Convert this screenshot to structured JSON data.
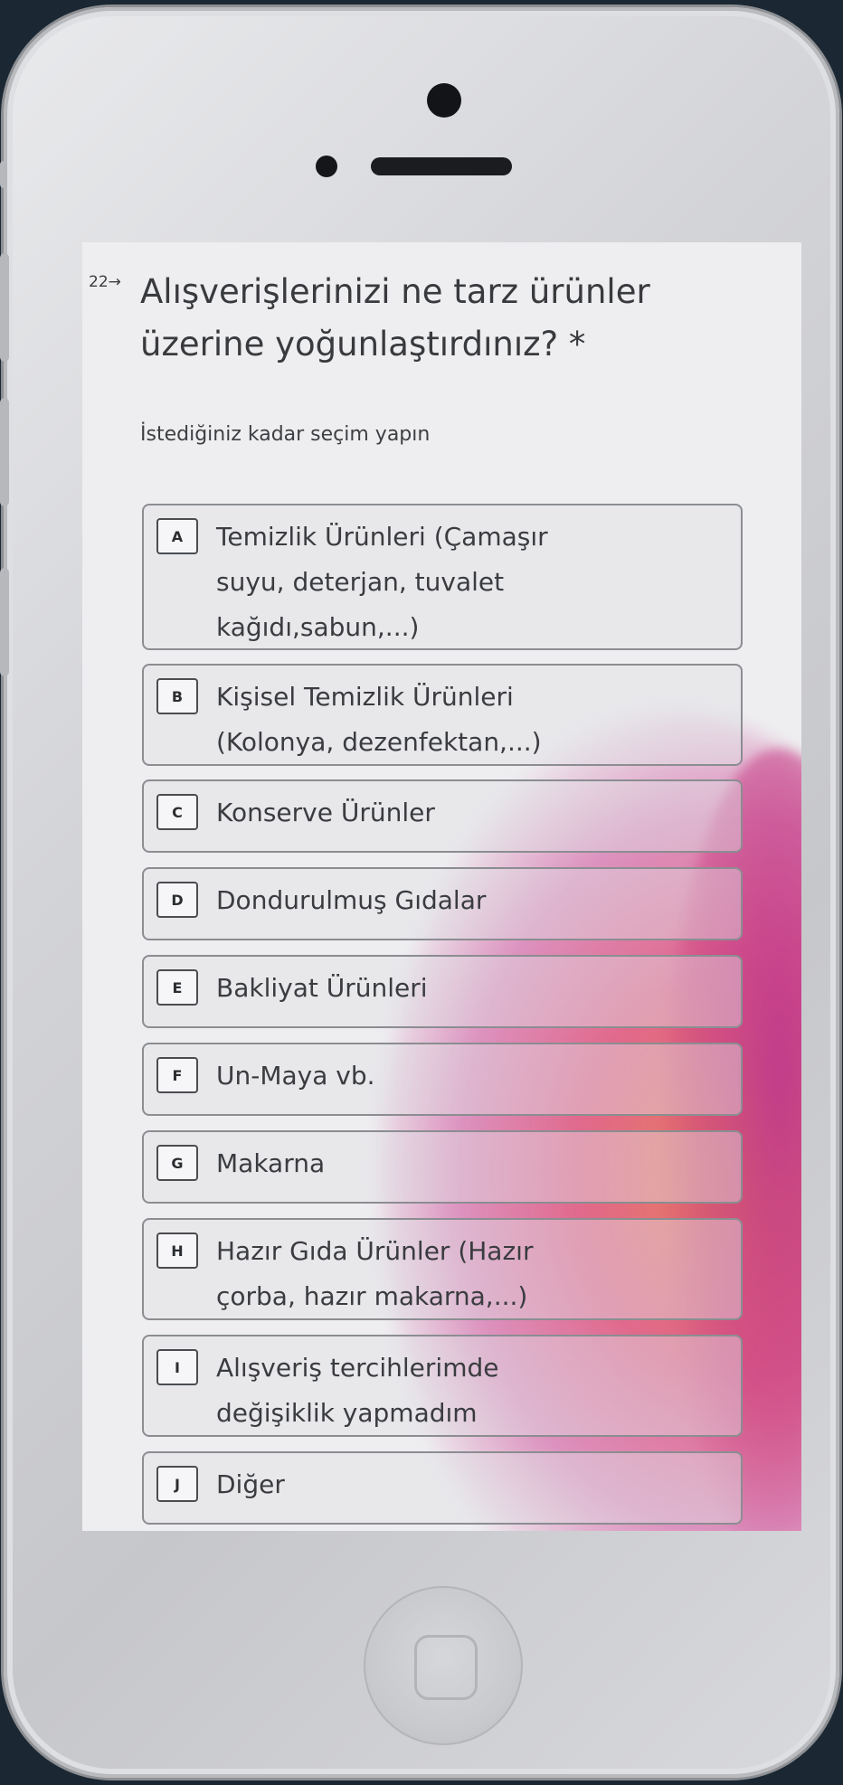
{
  "question": {
    "number": "22→",
    "title": "Alışverişlerinizi ne tarz ürünler üzerine yoğunlaştırdınız? *",
    "hint": "İstediğiniz kadar seçim yapın"
  },
  "options": [
    {
      "key": "A",
      "label": "Temizlik Ürünleri (Çamaşır suyu, deterjan, tuvalet kağıdı,sabun,...)"
    },
    {
      "key": "B",
      "label": "Kişisel Temizlik Ürünleri (Kolonya, dezenfektan,...)"
    },
    {
      "key": "C",
      "label": "Konserve Ürünler"
    },
    {
      "key": "D",
      "label": "Dondurulmuş Gıdalar"
    },
    {
      "key": "E",
      "label": "Bakliyat Ürünleri"
    },
    {
      "key": "F",
      "label": "Un-Maya vb."
    },
    {
      "key": "G",
      "label": "Makarna"
    },
    {
      "key": "H",
      "label": "Hazır Gıda Ürünler (Hazır çorba, hazır makarna,...)"
    },
    {
      "key": "I",
      "label": "Alışveriş tercihlerimde değişiklik yapmadım"
    },
    {
      "key": "J",
      "label": "Diğer"
    }
  ]
}
